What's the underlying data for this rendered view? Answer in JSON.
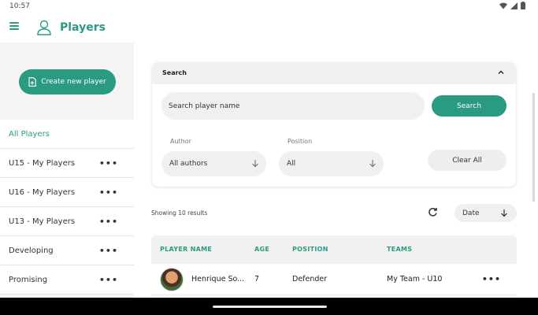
{
  "status_bar": {
    "time": "10:57",
    "icons": [
      "wifi-icon",
      "signal-icon",
      "battery-icon"
    ]
  },
  "app_bar": {
    "title": "Players",
    "menu_icon": "hamburger-menu-icon",
    "title_icon": "user-outline-icon"
  },
  "sidebar": {
    "create_button": "Create new player",
    "items": [
      {
        "label": "All Players",
        "active": true,
        "has_menu": false
      },
      {
        "label": "U15 - My Players",
        "active": false,
        "has_menu": true
      },
      {
        "label": "U16 - My Players",
        "active": false,
        "has_menu": true
      },
      {
        "label": "U13 - My Players",
        "active": false,
        "has_menu": true
      },
      {
        "label": "Developing",
        "active": false,
        "has_menu": true
      },
      {
        "label": "Promising",
        "active": false,
        "has_menu": true
      }
    ],
    "more_label": "•••"
  },
  "search": {
    "header": "Search",
    "placeholder": "Search player name",
    "button": "Search",
    "author_label": "Author",
    "author_value": "All authors",
    "position_label": "Position",
    "position_value": "All",
    "clear_button": "Clear All"
  },
  "results": {
    "showing_text": "Showing 10 results",
    "sort_value": "Date"
  },
  "table": {
    "headers": {
      "name": "PLAYER NAME",
      "age": "AGE",
      "position": "POSITION",
      "teams": "TEAMS"
    },
    "rows": [
      {
        "name": "Henrique So...",
        "age": "7",
        "position": "Defender",
        "teams": "My Team - U10",
        "more": "•••"
      }
    ]
  },
  "colors": {
    "accent": "#2a9a82",
    "surface": "#ffffff",
    "background": "#f4f4f4",
    "field": "#f0f0f0"
  }
}
